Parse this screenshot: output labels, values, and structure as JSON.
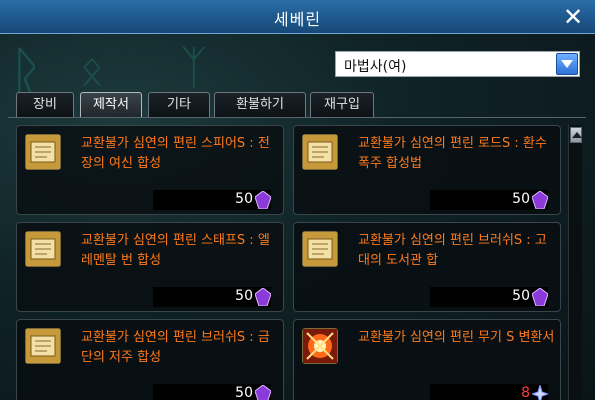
{
  "window": {
    "title": "세베린",
    "close_glyph": "✕"
  },
  "filter": {
    "selected": "마법사(여)"
  },
  "tabs": [
    {
      "label": "장비"
    },
    {
      "label": "제작서"
    },
    {
      "label": "기타"
    },
    {
      "label": "환불하기"
    },
    {
      "label": "재구입"
    }
  ],
  "active_tab": "제작서",
  "items": [
    {
      "name": "교환불가 심연의 편린 스피어S : 전장의 여신 합성",
      "price": "50",
      "icon": "scroll-icon"
    },
    {
      "name": "교환불가 심연의 편린 로드S : 환수폭주 합성법",
      "price": "50",
      "icon": "scroll-icon"
    },
    {
      "name": "교환불가 심연의 편린 스태프S : 엘레멘탈 번 합성",
      "price": "50",
      "icon": "scroll-icon"
    },
    {
      "name": "교환불가 심연의 편린 브러쉬S : 고대의 도서관 합",
      "price": "50",
      "icon": "scroll-icon"
    },
    {
      "name": "교환불가 심연의 편린 브러쉬S : 금단의 저주 합성",
      "price": "50",
      "icon": "scroll-icon"
    },
    {
      "name": "교환불가 심연의 편린 무기 S 변환서",
      "price": "8",
      "icon": "weapon-convert-icon"
    }
  ],
  "colors": {
    "item_name": "#ff7a1a",
    "price": "#ffffff",
    "price_low": "#ff3a3a",
    "title_bar": "#1f5a8f"
  }
}
